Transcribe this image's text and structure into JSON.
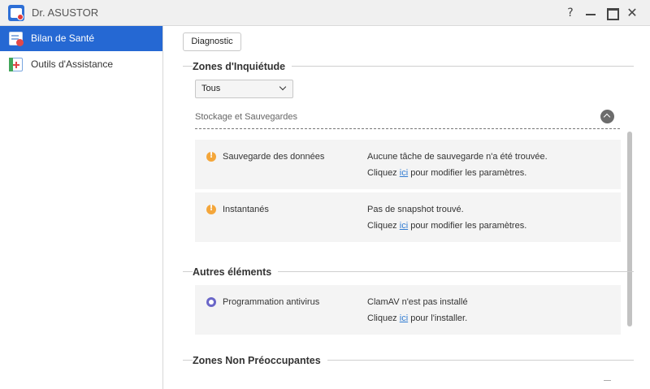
{
  "window": {
    "title": "Dr. ASUSTOR",
    "buttons": {
      "help": "?",
      "close": "✕"
    }
  },
  "sidebar": {
    "items": [
      {
        "label": "Bilan de Santé",
        "active": true
      },
      {
        "label": "Outils d'Assistance",
        "active": false
      }
    ]
  },
  "toolbar": {
    "diagnostic_label": "Diagnostic"
  },
  "concerns": {
    "title": "Zones d'Inquiétude",
    "filter": {
      "selected": "Tous"
    },
    "group": {
      "label": "Stockage et Sauvegardes"
    },
    "items": [
      {
        "name": "Sauvegarde des données",
        "message": "Aucune tâche de sauvegarde n'a été trouvée.",
        "action_prefix": "Cliquez ",
        "action_link": "ici",
        "action_suffix": " pour modifier les paramètres.",
        "status": "warning"
      },
      {
        "name": "Instantanés",
        "message": "Pas de snapshot trouvé.",
        "action_prefix": "Cliquez ",
        "action_link": "ici",
        "action_suffix": " pour modifier les paramètres.",
        "status": "warning"
      }
    ]
  },
  "other": {
    "title": "Autres éléments",
    "items": [
      {
        "name": "Programmation antivirus",
        "message": "ClamAV n'est pas installé",
        "action_prefix": "Cliquez ",
        "action_link": "ici",
        "action_suffix": " pour l'installer.",
        "status": "info"
      }
    ]
  },
  "non_concerns": {
    "title": "Zones Non Préoccupantes"
  },
  "colors": {
    "accent": "#2568d3",
    "warning": "#f4a63a",
    "info": "#6a66c8",
    "link": "#2e7ad1"
  }
}
